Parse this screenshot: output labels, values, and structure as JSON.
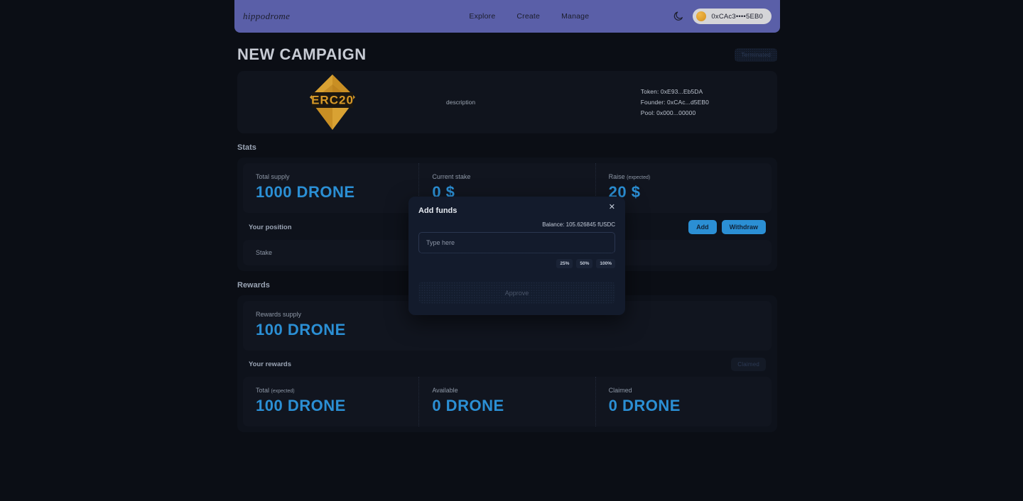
{
  "header": {
    "logo": "hippodrome",
    "nav": [
      {
        "label": "Explore"
      },
      {
        "label": "Create"
      },
      {
        "label": "Manage"
      }
    ],
    "theme_toggle_icon": "moon-icon",
    "wallet": {
      "address": "0xCAc3••••5EB0",
      "avatar_color": "#e0a63a"
    }
  },
  "campaign": {
    "title": "NEW CAMPAIGN",
    "status_badge": "Terminated",
    "logo_text": "ERC20",
    "description": "description",
    "meta": {
      "token": "Token: 0xE93...Eb5DA",
      "founder": "Founder: 0xCAc...d5EB0",
      "pool": "Pool: 0x000...00000"
    }
  },
  "stats": {
    "section_title": "Stats",
    "cells": [
      {
        "label": "Total supply",
        "sub": "",
        "value": "1000  DRONE"
      },
      {
        "label": "Current stake",
        "sub": "",
        "value": "0 $"
      },
      {
        "label": "Raise ",
        "sub": "(expected)",
        "value": "20 $"
      }
    ]
  },
  "position": {
    "title": "Your position",
    "add_label": "Add",
    "withdraw_label": "Withdraw",
    "stake_label": "Stake"
  },
  "rewards": {
    "section_title": "Rewards",
    "supply_label": "Rewards supply",
    "supply_value": "100 DRONE",
    "your_rewards_title": "Your rewards",
    "claimed_badge": "Claimed",
    "cells": [
      {
        "label": "Total ",
        "sub": "(expected)",
        "value": "100 DRONE"
      },
      {
        "label": "Available",
        "sub": "",
        "value": "0  DRONE"
      },
      {
        "label": "Claimed",
        "sub": "",
        "value": "0  DRONE"
      }
    ]
  },
  "modal": {
    "title": "Add funds",
    "close_icon": "close-icon",
    "balance": "Balance: 105.626845 fUSDC",
    "input_value": "",
    "input_placeholder": "Type here",
    "percent_buttons": [
      {
        "label": "25%"
      },
      {
        "label": "50%"
      },
      {
        "label": "100%"
      }
    ],
    "approve_label": "Approve"
  },
  "colors": {
    "accent_blue": "#2b8fd4",
    "header_purple": "#5a5fa8",
    "logo_gold": "#d99a27",
    "page_bg": "#0b0e15"
  }
}
